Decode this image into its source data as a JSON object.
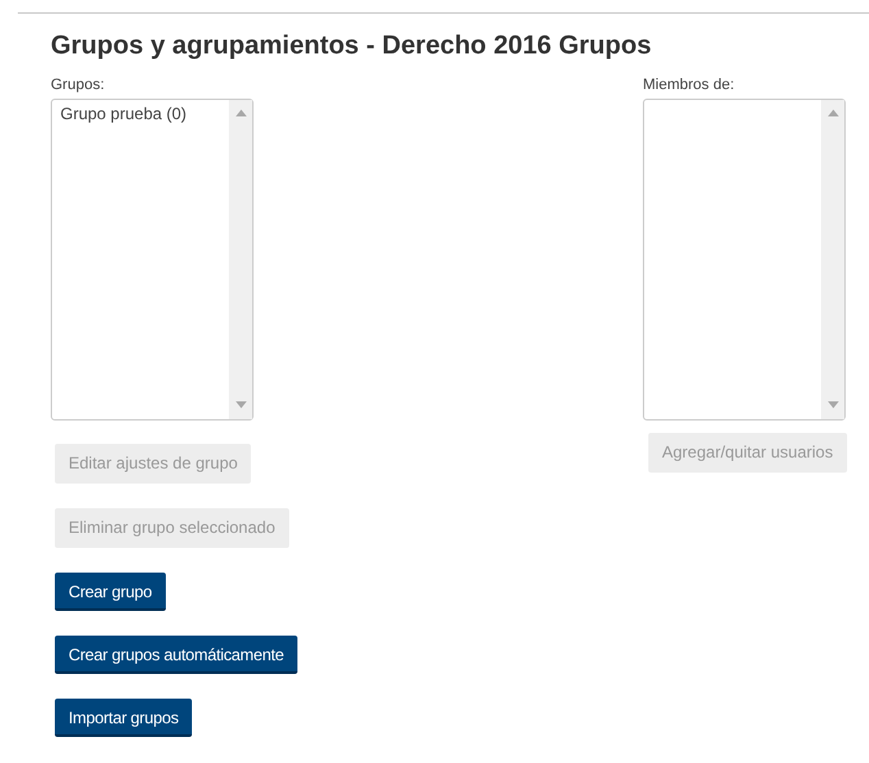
{
  "title": "Grupos y agrupamientos - Derecho 2016 Grupos",
  "groups": {
    "label": "Grupos:",
    "items": [
      {
        "text": "Grupo prueba (0)",
        "selected": false
      }
    ],
    "buttons": [
      {
        "label": "Editar ajustes de grupo",
        "disabled": true
      },
      {
        "label": "Eliminar grupo seleccionado",
        "disabled": true
      },
      {
        "label": "Crear grupo",
        "disabled": false
      },
      {
        "label": "Crear grupos automáticamente",
        "disabled": false
      },
      {
        "label": "Importar grupos",
        "disabled": false
      }
    ]
  },
  "members": {
    "label": "Miembros de:",
    "buttons": [
      {
        "label": "Agregar/quitar usuarios",
        "disabled": true
      }
    ]
  }
}
